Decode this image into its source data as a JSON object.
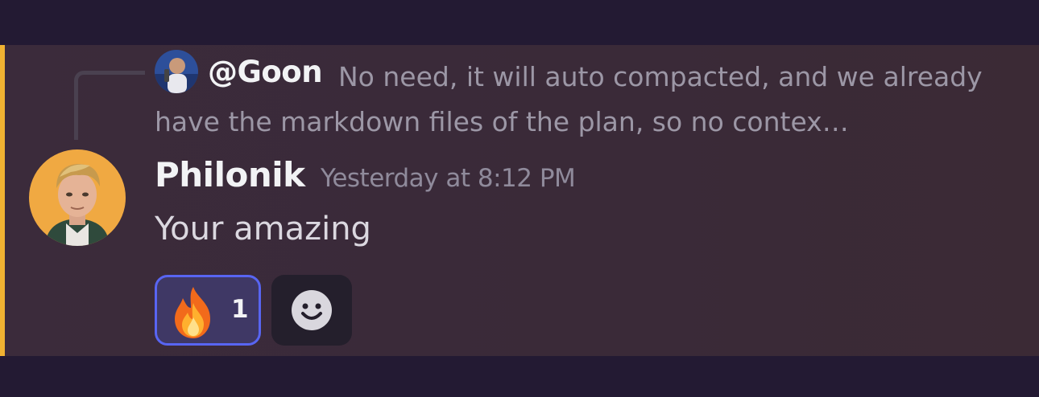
{
  "reply": {
    "mention": "@Goon",
    "preview": "No need, it will auto compacted, and we already have the markdown files of the plan, so no contex…"
  },
  "message": {
    "author": "Philonik",
    "timestamp": "Yesterday at 8:12 PM",
    "text": "Your amazing"
  },
  "reactions": [
    {
      "emoji": "fire-icon",
      "count": "1",
      "selected": true
    }
  ],
  "add_reaction": {
    "icon": "smile-icon"
  },
  "colors": {
    "mention_bar": "#f0b232",
    "reaction_border": "#5865f2",
    "reaction_bg": "#3f3865"
  }
}
